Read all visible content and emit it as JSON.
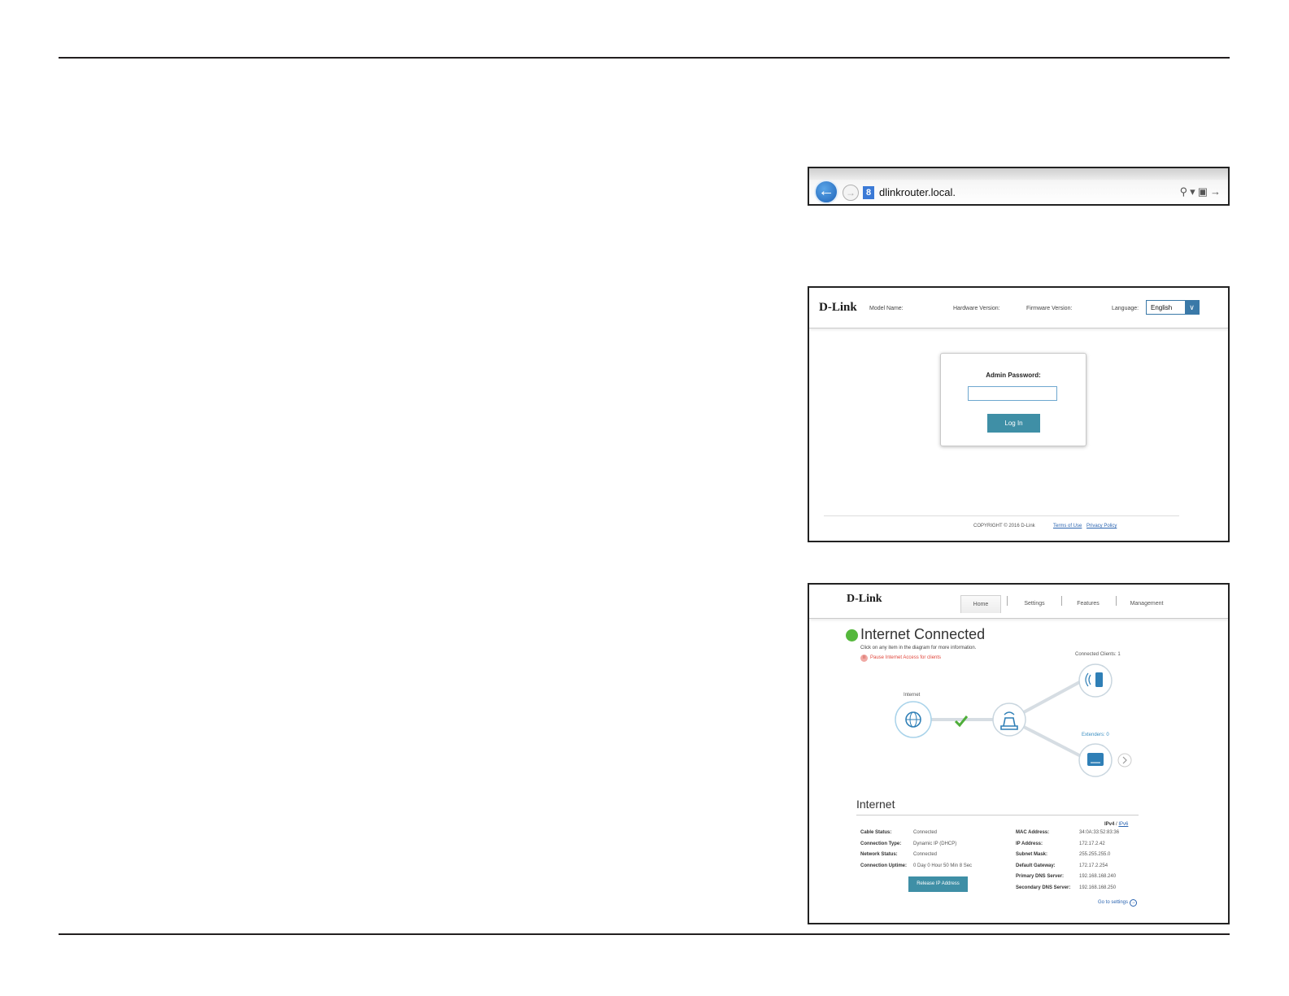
{
  "browser": {
    "url": "dlinkrouter.local.",
    "favicon": "8",
    "back_icon": "back-arrow-icon",
    "forward_icon": "forward-arrow-icon",
    "tools_icons": [
      "search-icon",
      "dropdown-icon",
      "lock-icon",
      "go-arrow-icon"
    ]
  },
  "login_page": {
    "logo": "D-Link",
    "model_name_label": "Model Name:",
    "hardware_version_label": "Hardware Version:",
    "firmware_version_label": "Firmware Version:",
    "language_label": "Language:",
    "language_value": "English",
    "admin_password_label": "Admin Password:",
    "login_button": "Log In",
    "copyright": "COPYRIGHT © 2016 D-Link",
    "terms_link": "Terms of Use",
    "privacy_link": "Privacy Policy"
  },
  "home_page": {
    "logo": "D-Link",
    "nav": [
      "Home",
      "Settings",
      "Features",
      "Management"
    ],
    "active_nav": "Home",
    "status_title": "Internet Connected",
    "hint": "Click on any item in the diagram for more information.",
    "pause_text": "Pause Internet Access for clients",
    "diagram": {
      "internet_label": "Internet",
      "connected_clients_label": "Connected Clients: 1",
      "extenders_label": "Extenders: 0"
    },
    "section_title": "Internet",
    "ipv4": "IPv4",
    "ipv_sep": "/",
    "ipv6": "IPv6",
    "left_info": [
      {
        "label": "Cable Status:",
        "value": "Connected"
      },
      {
        "label": "Connection Type:",
        "value": "Dynamic IP (DHCP)"
      },
      {
        "label": "Network Status:",
        "value": "Connected"
      },
      {
        "label": "Connection Uptime:",
        "value": "0 Day 0 Hour 50 Min 8 Sec"
      }
    ],
    "right_info": [
      {
        "label": "MAC Address:",
        "value": "34:0A:33:52:83:36"
      },
      {
        "label": "IP Address:",
        "value": "172.17.2.42"
      },
      {
        "label": "Subnet Mask:",
        "value": "255.255.255.0"
      },
      {
        "label": "Default Gateway:",
        "value": "172.17.2.254"
      },
      {
        "label": "Primary DNS Server:",
        "value": "192.168.168.240"
      },
      {
        "label": "Secondary DNS Server:",
        "value": "192.168.168.250"
      }
    ],
    "release_button": "Release IP Address",
    "go_to_settings": "Go to settings"
  },
  "colors": {
    "accent": "#3f8fa6",
    "connected_green": "#55b83c",
    "link_blue": "#2a64b0"
  }
}
